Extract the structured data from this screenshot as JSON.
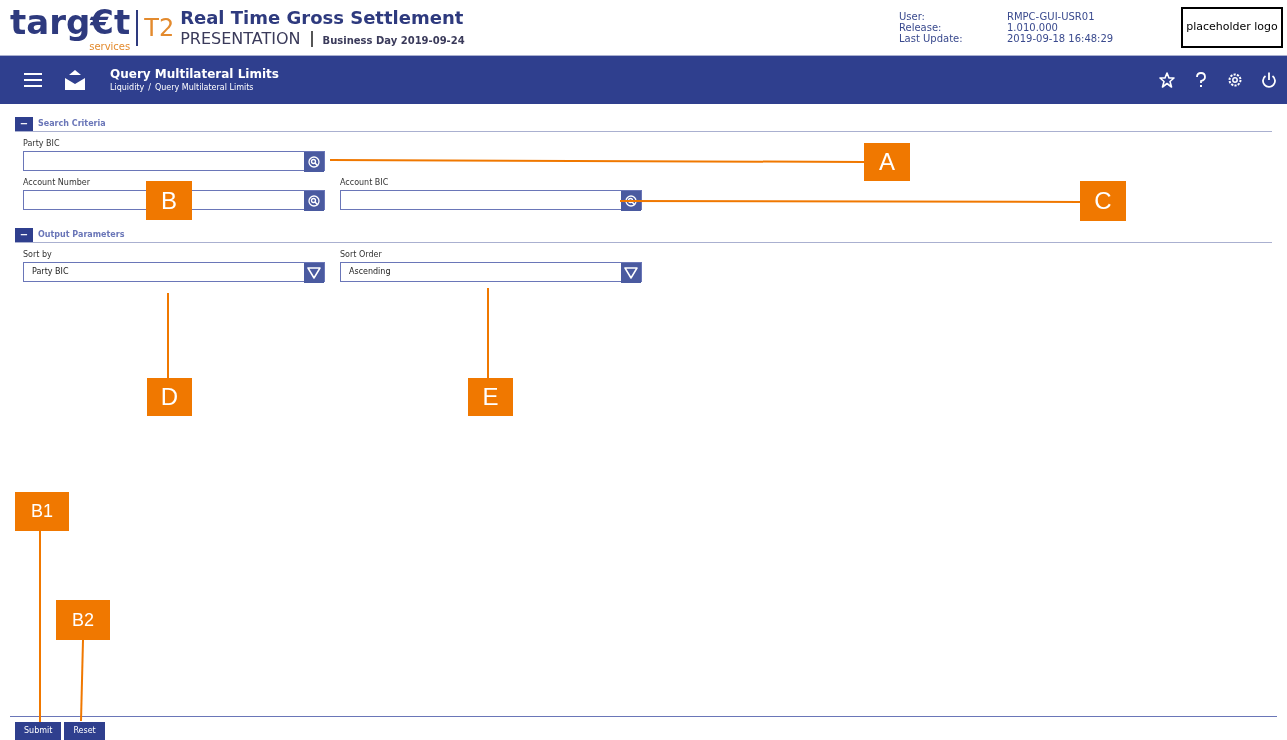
{
  "header": {
    "logo_word": "targ€t",
    "logo_sub": "services",
    "product": "T2",
    "title": "Real Time Gross Settlement",
    "environment": "PRESENTATION",
    "business_day": "Business Day 2019-09-24",
    "info": [
      {
        "label": "User:",
        "value": "RMPC-GUI-USR01"
      },
      {
        "label": "Release:",
        "value": "1.010.000"
      },
      {
        "label": "Last Update:",
        "value": "2019-09-18 16:48:29"
      }
    ],
    "placeholder_logo": "placeholder logo"
  },
  "nav_bar": {
    "title": "Query Multilateral Limits",
    "breadcrumb": [
      "Liquidity",
      "Query Multilateral Limits"
    ],
    "breadcrumb_separator": "/"
  },
  "sections": [
    {
      "title": "Search Criteria",
      "expanded": true,
      "toggle": "−",
      "rows": [
        [
          {
            "label": "Party BIC",
            "kind": "lookup"
          }
        ],
        [
          {
            "label": "Account Number",
            "kind": "lookup"
          },
          {
            "label": "Account BIC",
            "kind": "lookup"
          }
        ]
      ]
    },
    {
      "title": "Output Parameters",
      "expanded": true,
      "toggle": "−",
      "rows": [
        [
          {
            "label": "Sort by",
            "kind": "select",
            "value": "Party BIC"
          },
          {
            "label": "Sort Order",
            "kind": "select",
            "value": "Ascending"
          }
        ]
      ]
    }
  ],
  "buttons": [
    "Submit",
    "Reset"
  ],
  "callouts": [
    {
      "label": "A"
    },
    {
      "label": "B"
    },
    {
      "label": "C"
    },
    {
      "label": "D"
    },
    {
      "label": "E"
    },
    {
      "label": "B1"
    },
    {
      "label": "B2"
    }
  ]
}
